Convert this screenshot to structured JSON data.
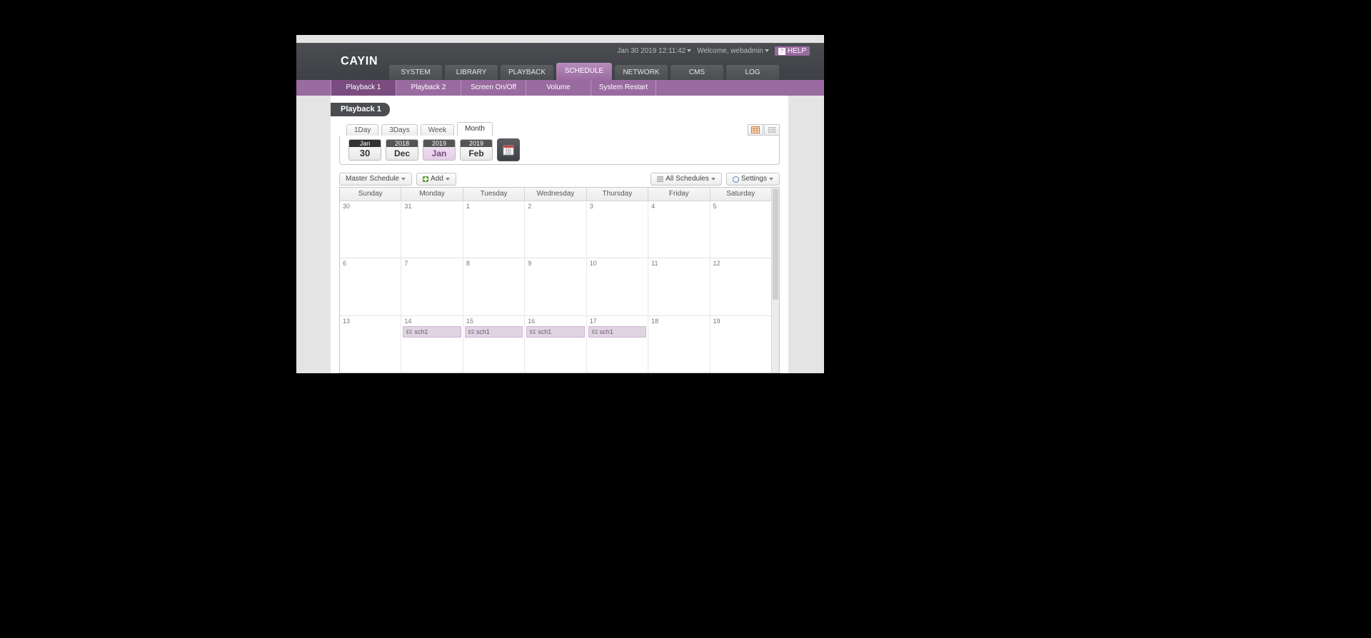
{
  "header": {
    "datetime": "Jan 30 2019 12:11:42",
    "welcome": "Welcome, webadmin",
    "help": "HELP",
    "brand": "CAYIN"
  },
  "main_nav": [
    {
      "label": "SYSTEM"
    },
    {
      "label": "LIBRARY"
    },
    {
      "label": "PLAYBACK"
    },
    {
      "label": "SCHEDULE",
      "active": true
    },
    {
      "label": "NETWORK"
    },
    {
      "label": "CMS"
    },
    {
      "label": "LOG"
    }
  ],
  "sub_nav": [
    {
      "label": "Playback 1",
      "active": true
    },
    {
      "label": "Playback 2"
    },
    {
      "label": "Screen On/Off"
    },
    {
      "label": "Volume"
    },
    {
      "label": "System Restart"
    }
  ],
  "page_title": "Playback 1",
  "view_tabs": [
    {
      "label": "1Day"
    },
    {
      "label": "3Days"
    },
    {
      "label": "Week"
    },
    {
      "label": "Month",
      "active": true
    }
  ],
  "date_nav": [
    {
      "top": "Jan",
      "bot": "30",
      "today": true
    },
    {
      "top": "2018",
      "bot": "Dec"
    },
    {
      "top": "2019",
      "bot": "Jan",
      "active": true
    },
    {
      "top": "2019",
      "bot": "Feb"
    }
  ],
  "toolbar": {
    "master": "Master Schedule",
    "add": "Add",
    "all": "All Schedules",
    "settings": "Settings"
  },
  "calendar": {
    "days": [
      "Sunday",
      "Monday",
      "Tuesday",
      "Wednesday",
      "Thursday",
      "Friday",
      "Saturday"
    ],
    "rows": [
      [
        {
          "n": "30"
        },
        {
          "n": "31"
        },
        {
          "n": "1"
        },
        {
          "n": "2"
        },
        {
          "n": "3"
        },
        {
          "n": "4"
        },
        {
          "n": "5"
        }
      ],
      [
        {
          "n": "6"
        },
        {
          "n": "7"
        },
        {
          "n": "8"
        },
        {
          "n": "9"
        },
        {
          "n": "10"
        },
        {
          "n": "11"
        },
        {
          "n": "12"
        }
      ],
      [
        {
          "n": "13"
        },
        {
          "n": "14",
          "ev": "sch1"
        },
        {
          "n": "15",
          "ev": "sch1"
        },
        {
          "n": "16",
          "ev": "sch1"
        },
        {
          "n": "17",
          "ev": "sch1"
        },
        {
          "n": "18"
        },
        {
          "n": "19"
        }
      ]
    ]
  }
}
